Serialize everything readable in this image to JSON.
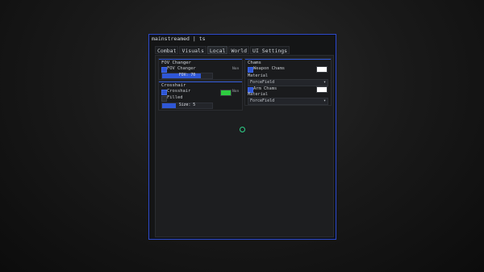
{
  "window": {
    "title": "mainstreamed | ts"
  },
  "tabs": [
    {
      "label": "Combat"
    },
    {
      "label": "Visuals"
    },
    {
      "label": "Local"
    },
    {
      "label": "World"
    },
    {
      "label": "UI Settings"
    }
  ],
  "fov_panel": {
    "title": "FOV Changer",
    "toggle_label": "FOV Changer",
    "keybind": "Non",
    "slider_text": "FOV: 70",
    "slider_fraction": 0.78
  },
  "crosshair_panel": {
    "title": "Crosshair",
    "toggle_label": "Crosshair",
    "keybind": "Non",
    "filled_label": "Filled",
    "slider_text": "Size: 5",
    "slider_fraction": 0.28,
    "color": "#2ecc40"
  },
  "chams_panel": {
    "title": "Chams",
    "weapon_label": "Weapon Chams",
    "weapon_color": "#ffffff",
    "material_label_1": "Material",
    "material_value_1": "ForceField",
    "arm_label": "Arm Chams",
    "arm_color": "#ffffff",
    "material_label_2": "Material",
    "material_value_2": "ForceField"
  },
  "colors": {
    "accent": "#2f57d6",
    "border": "#2f4bc7"
  }
}
